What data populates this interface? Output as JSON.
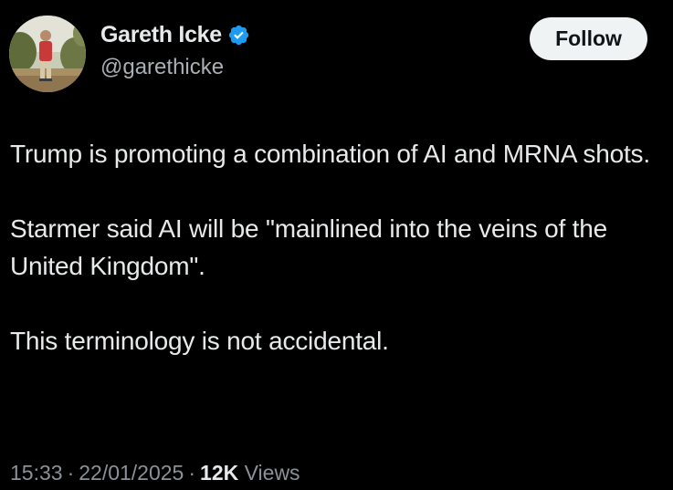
{
  "author": {
    "display_name": "Gareth Icke",
    "handle": "@garethicke",
    "verified": true,
    "avatar_icon": "profile-photo-icon",
    "verified_icon": "verified-badge-icon"
  },
  "follow_button": {
    "label": "Follow"
  },
  "tweet": {
    "paragraphs": [
      "Trump is promoting a combination of AI and MRNA shots.",
      "Starmer said AI will be \"mainlined into the veins of the United Kingdom\".",
      "This terminology is not accidental."
    ]
  },
  "meta": {
    "time": "15:33",
    "separator": "·",
    "date": "22/01/2025",
    "views_count": "12K",
    "views_label": "Views"
  },
  "colors": {
    "background": "#000000",
    "text_primary": "#e7e9ea",
    "text_secondary": "#8b9197",
    "verified": "#1d9bf0",
    "button_bg": "#eff3f4"
  }
}
